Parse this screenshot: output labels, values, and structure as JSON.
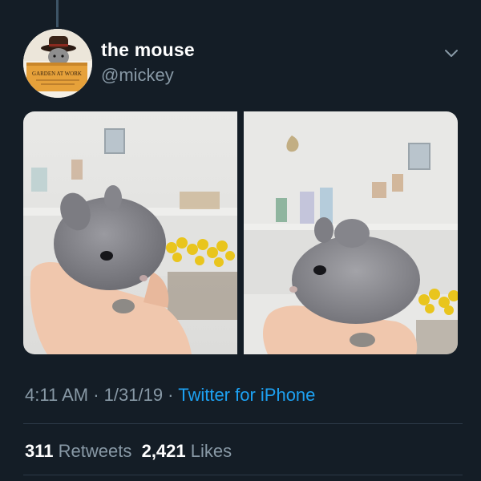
{
  "user": {
    "display_name": "the mouse",
    "handle": "@mickey",
    "avatar_sign_text": "GARDEN AT WORK"
  },
  "media": {
    "photos": [
      {
        "subject": "grey baby bunny held in hand"
      },
      {
        "subject": "grey baby bunny held in hand"
      }
    ]
  },
  "meta": {
    "time": "4:11 AM",
    "separator1": " · ",
    "date": "1/31/19",
    "separator2": " · ",
    "source": "Twitter for iPhone"
  },
  "stats": {
    "retweets_count": "311",
    "retweets_label": "Retweets",
    "likes_count": "2,421",
    "likes_label": "Likes"
  },
  "colors": {
    "background": "#141d26",
    "text_primary": "#ffffff",
    "text_secondary": "#8899a6",
    "link": "#1da1f2",
    "divider": "#2c3a47"
  },
  "icons": {
    "more": "chevron-down-icon"
  }
}
